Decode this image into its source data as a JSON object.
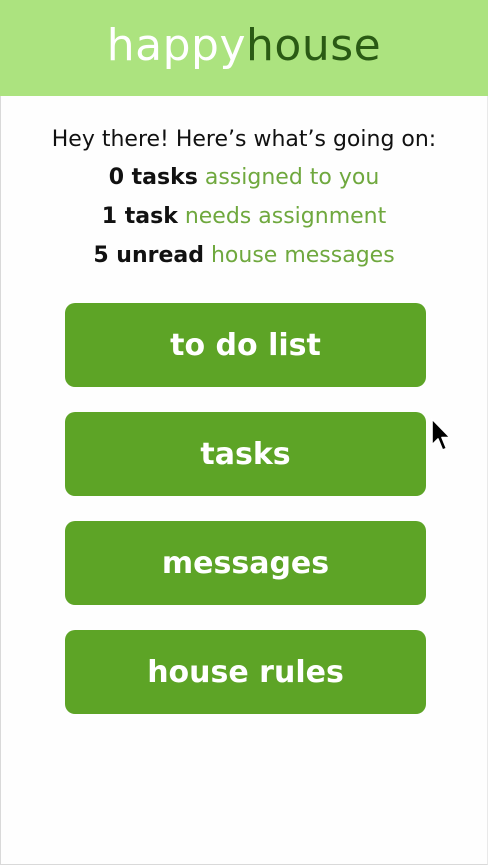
{
  "header": {
    "brand_part1": "happy",
    "brand_part2": "house"
  },
  "summary": {
    "greeting": "Hey there! Here’s what’s going on:",
    "rows": [
      {
        "count": "0 tasks",
        "text": "assigned to you"
      },
      {
        "count": "1 task",
        "text": "needs assignment"
      },
      {
        "count": "5 unread",
        "text": "house messages"
      }
    ]
  },
  "buttons": [
    {
      "label": "to do list"
    },
    {
      "label": "tasks"
    },
    {
      "label": "messages"
    },
    {
      "label": "house rules"
    }
  ],
  "colors": {
    "header_bg": "#ace37f",
    "brand_dark": "#2a5a14",
    "button_bg": "#5da426",
    "accent_text": "#6fa83e"
  },
  "icons": {
    "cursor": "mouse-pointer-icon"
  }
}
